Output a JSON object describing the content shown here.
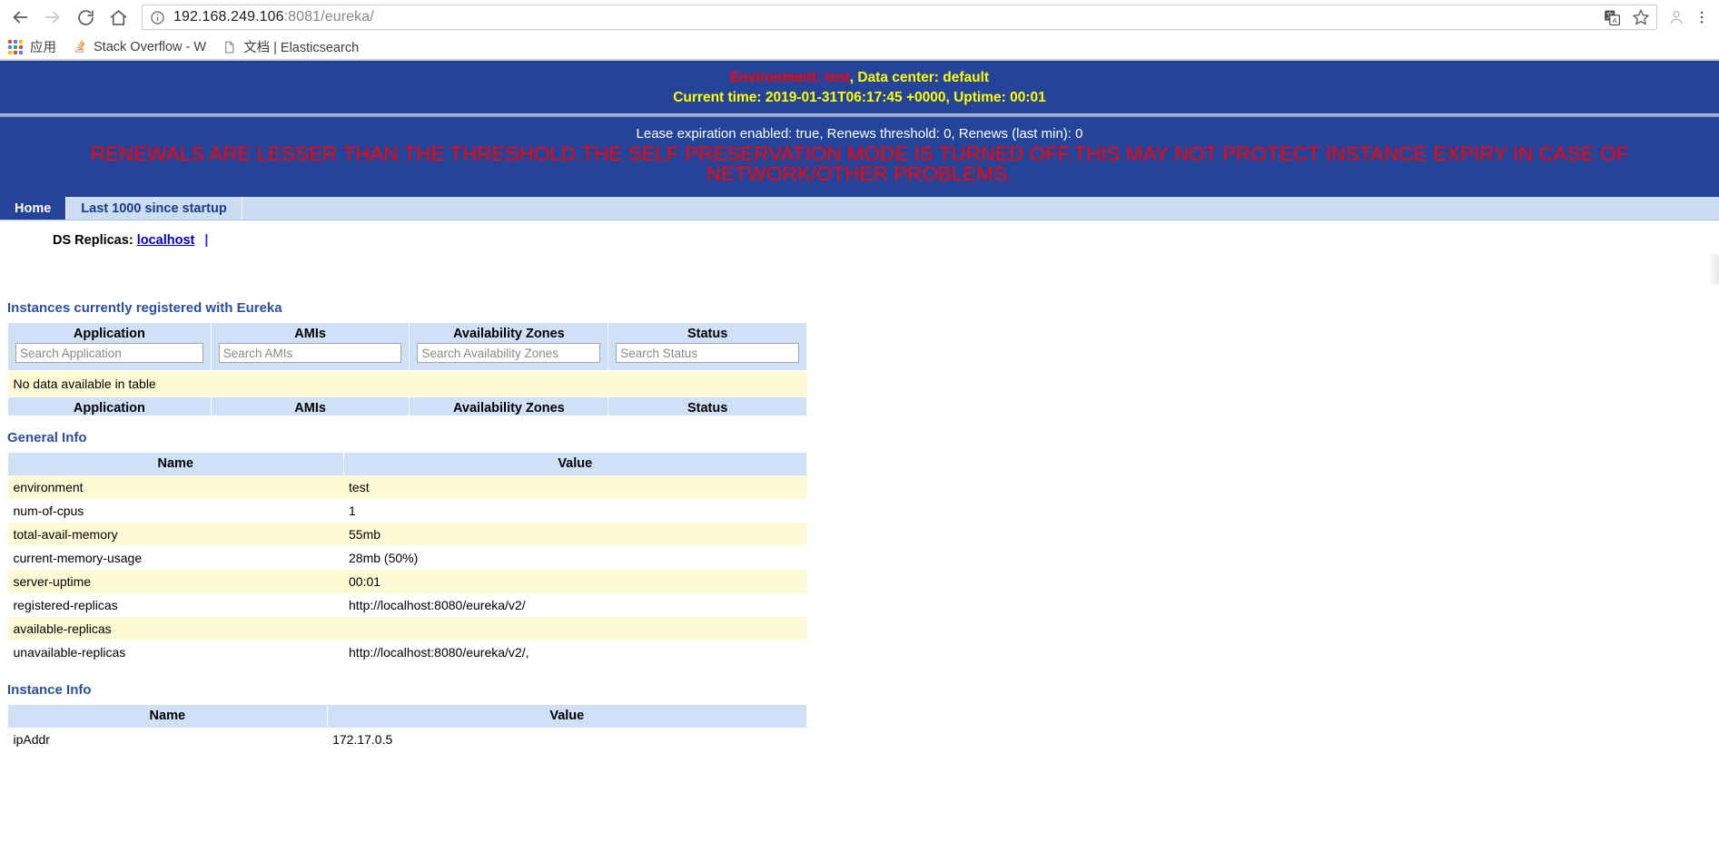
{
  "browser": {
    "back_label": "Back",
    "forward_label": "Forward",
    "reload_label": "Reload",
    "home_label": "Home",
    "url_host": "192.168.249.106",
    "url_rest": ":8081/eureka/",
    "site_info_label": "View site information",
    "translate_label": "Translate this page",
    "bookmark_label": "Bookmark this page",
    "profile_label": "Profile",
    "menu_label": "Customize and control Google Chrome",
    "bookmarks": [
      {
        "label": "应用",
        "icon": "apps-grid-icon"
      },
      {
        "label": "Stack Overflow - W",
        "icon": "stackoverflow-icon"
      },
      {
        "label": "文档 | Elasticsearch",
        "icon": "document-icon"
      }
    ]
  },
  "banner": {
    "environment_prefix": "Environment: ",
    "environment_value": "test",
    "datacenter_text": ", Data center: default",
    "time_line": "Current time: 2019-01-31T06:17:45 +0000, Uptime: 00:01",
    "lease_line": "Lease expiration enabled: true, Renews threshold: 0, Renews (last min): 0",
    "warning": "RENEWALS ARE LESSER THAN THE THRESHOLD.THE SELF PRESERVATION MODE IS TURNED OFF.THIS MAY NOT PROTECT INSTANCE EXPIRY IN CASE OF NETWORK/OTHER PROBLEMS.",
    "colors": {
      "background": "#24449a",
      "text_yellow": "#ffff00",
      "env_red": "#ff0000",
      "warning_red": "#ff0000",
      "lease_white": "#ffffff"
    }
  },
  "tabs": [
    {
      "label": "Home",
      "active": true
    },
    {
      "label": "Last 1000 since startup",
      "active": false
    }
  ],
  "ds_replicas": {
    "label": "DS Replicas:",
    "link": "localhost",
    "separator": "|"
  },
  "instances": {
    "title": "Instances currently registered with Eureka",
    "headers": [
      "Application",
      "AMIs",
      "Availability Zones",
      "Status"
    ],
    "search_placeholders": [
      "Search Application",
      "Search AMIs",
      "Search Availability Zones",
      "Search Status"
    ],
    "empty_message": "No data available in table",
    "footers": [
      "Application",
      "AMIs",
      "Availability Zones",
      "Status"
    ]
  },
  "general_info": {
    "title": "General Info",
    "headers": [
      "Name",
      "Value"
    ],
    "rows": [
      {
        "name": "environment",
        "value": "test"
      },
      {
        "name": "num-of-cpus",
        "value": "1"
      },
      {
        "name": "total-avail-memory",
        "value": "55mb"
      },
      {
        "name": "current-memory-usage",
        "value": "28mb (50%)"
      },
      {
        "name": "server-uptime",
        "value": "00:01"
      },
      {
        "name": "registered-replicas",
        "value": "http://localhost:8080/eureka/v2/"
      },
      {
        "name": "available-replicas",
        "value": ""
      },
      {
        "name": "unavailable-replicas",
        "value": "http://localhost:8080/eureka/v2/,"
      }
    ]
  },
  "instance_info": {
    "title": "Instance Info",
    "headers": [
      "Name",
      "Value"
    ],
    "rows": [
      {
        "name": "ipAddr",
        "value": "172.17.0.5"
      }
    ]
  }
}
